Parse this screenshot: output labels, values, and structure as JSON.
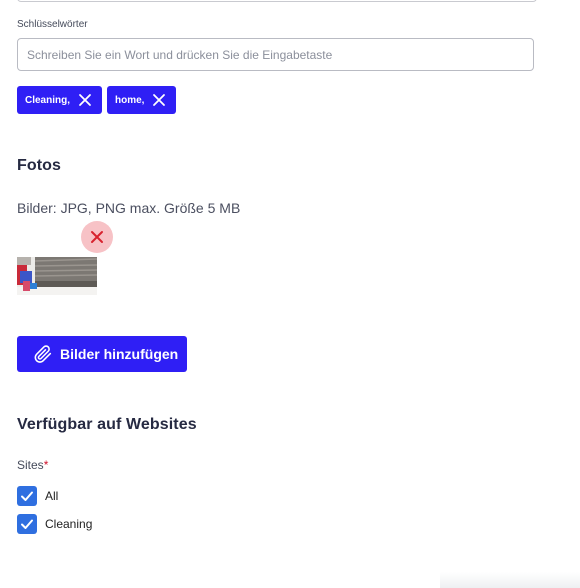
{
  "keywords": {
    "label": "Schlüsselwörter",
    "placeholder": "Schreiben Sie ein Wort und drücken Sie die Eingabetaste",
    "value": "",
    "tags": [
      {
        "label": "Cleaning,"
      },
      {
        "label": "home,"
      }
    ]
  },
  "photos": {
    "heading": "Fotos",
    "hint": "Bilder: JPG, PNG max. Größe 5 MB",
    "remove_icon": "close-icon",
    "add_button_label": "Bilder hinzufügen",
    "add_button_icon": "paperclip-icon"
  },
  "availability": {
    "heading": "Verfügbar auf Websites",
    "sites_label": "Sites",
    "required_mark": "*",
    "options": [
      {
        "label": "All",
        "checked": true
      },
      {
        "label": "Cleaning",
        "checked": true
      }
    ]
  },
  "colors": {
    "accent": "#2f1ff5",
    "checkbox": "#2f6fe0",
    "remove_bg": "#f7c2c6",
    "remove_x": "#d8232f",
    "required": "#d0112b"
  }
}
